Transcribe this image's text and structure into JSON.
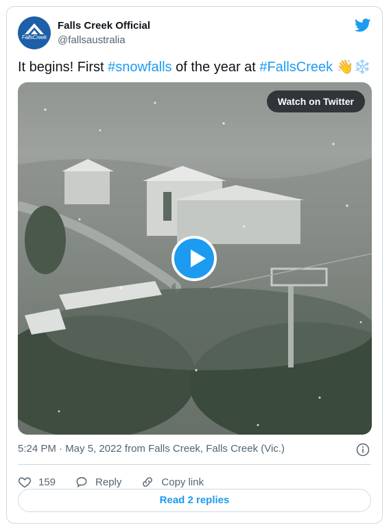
{
  "account": {
    "display_name": "Falls Creek Official",
    "handle": "@fallsaustralia",
    "avatar_text": "FallsCreek"
  },
  "tweet": {
    "text_parts": {
      "p1": "It begins! First ",
      "tag1": "#snowfalls",
      "p2": " of the year at ",
      "tag2": "#FallsCreek",
      "emoji": " 👋❄️"
    },
    "timestamp": "5:24 PM · May 5, 2022 from Falls Creek, Falls Creek (Vic.)"
  },
  "media": {
    "watch_label": "Watch on Twitter",
    "play_icon": "play-icon"
  },
  "actions": {
    "like_count": "159",
    "reply_label": "Reply",
    "copy_label": "Copy link"
  },
  "footer": {
    "read_replies_label": "Read 2 replies"
  },
  "colors": {
    "accent": "#1d9bf0",
    "text_secondary": "#536471",
    "border": "#cfd9de",
    "avatar_bg": "#1d5fa8"
  }
}
